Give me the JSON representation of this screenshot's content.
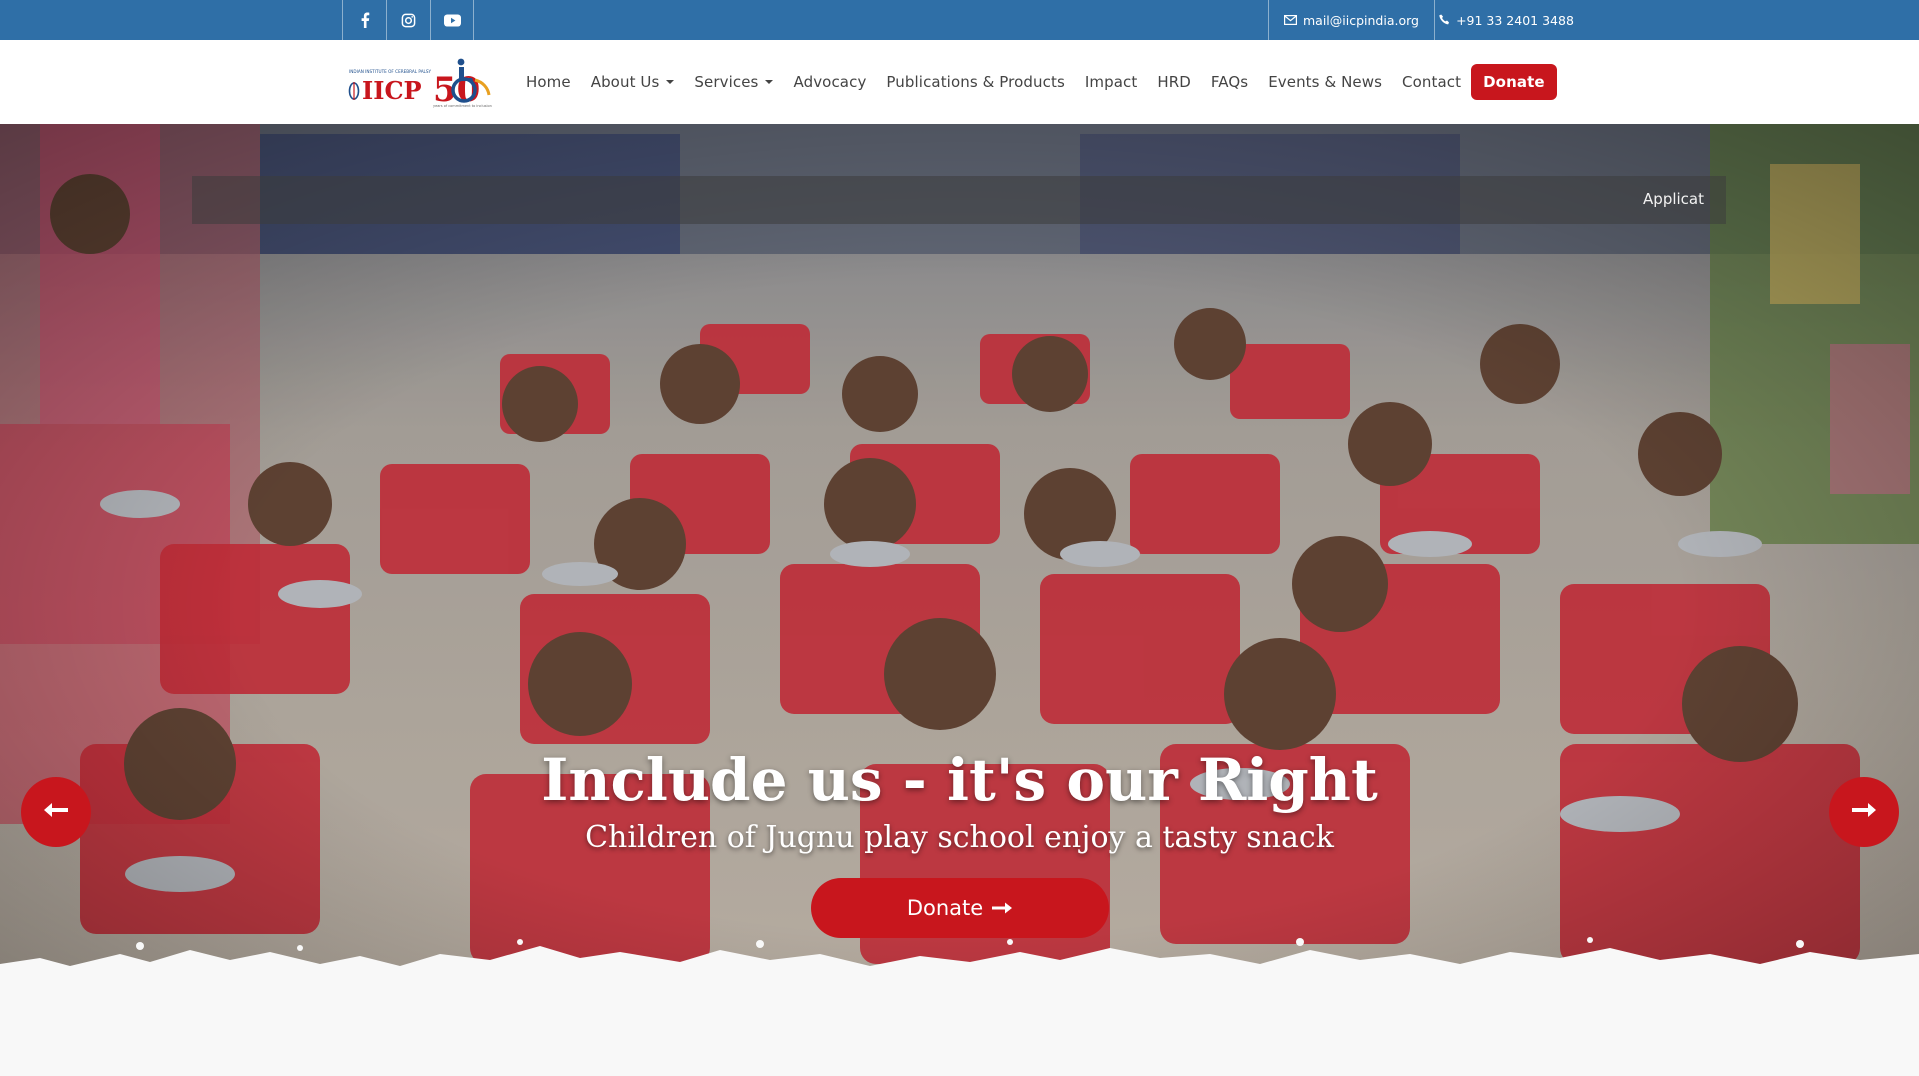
{
  "topbar": {
    "social": [
      {
        "name": "facebook-icon"
      },
      {
        "name": "instagram-icon"
      },
      {
        "name": "youtube-icon"
      }
    ],
    "email": "mail@iicpindia.org",
    "phone": "+91 33 2401 3488",
    "email_icon": "envelope-icon",
    "phone_icon": "phone-icon"
  },
  "logo": {
    "org_line": "INDIAN INSTITUTE OF CEREBRAL PALSY",
    "wordmark": "IICP",
    "anniversary": "50",
    "tagline": "years of commitment to inclusion"
  },
  "nav": {
    "home": "Home",
    "about": "About Us",
    "services": "Services",
    "advocacy": "Advocacy",
    "publications": "Publications & Products",
    "impact": "Impact",
    "hrd": "HRD",
    "faqs": "FAQs",
    "events": "Events & News",
    "contact": "Contact",
    "donate": "Donate"
  },
  "hero": {
    "ticker": "Applicat",
    "title": "Include us - it's our Right",
    "subtitle": "Children of Jugnu play school enjoy a tasty snack",
    "donate_label": "Donate",
    "donate_icon": "arrow-right-icon",
    "prev_icon": "arrow-left-icon",
    "next_icon": "arrow-right-icon"
  },
  "colors": {
    "topbar": "#2f6fa7",
    "accent": "#c8161d",
    "nav_text": "#444444"
  }
}
